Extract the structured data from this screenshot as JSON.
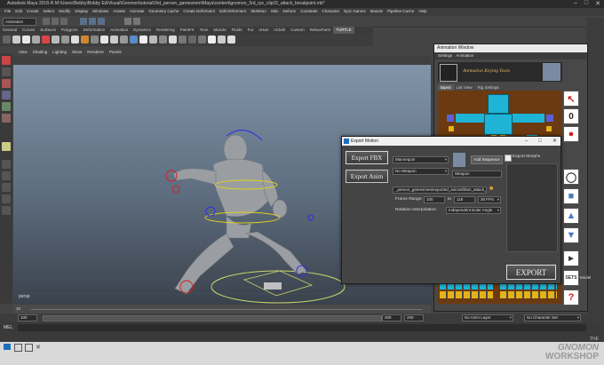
{
  "app": {
    "title": "Autodesk Maya 2018.4\\ M:\\Users\\Bobby\\Bobby Ed\\Visual\\Gnomon\\tutorial\\3rd_person_gamesmen\\Maya\\content\\gnomon_3rd_rpc_clip15_attack_breakpoint.mb*"
  },
  "menus": [
    "File",
    "Edit",
    "Create",
    "Select",
    "Modify",
    "Display",
    "Windows",
    "Assets",
    "Animate",
    "Geometry Cache",
    "Create Deformers",
    "Edit Deformers",
    "Skeleton",
    "Skin",
    "Deform",
    "Constrain",
    "Character",
    "Epic Games",
    "Muscle",
    "Pipeline Cache",
    "Help"
  ],
  "workspace_label": "Animation",
  "shelf_tabs": [
    "General",
    "Curves",
    "Surfaces",
    "Polygons",
    "Deformation",
    "Animation",
    "Dynamics",
    "Rendering",
    "PaintFX",
    "Toon",
    "Muscle",
    "Fluids",
    "Fur",
    "nHair",
    "nCloth",
    "Custom",
    "RebusFarm",
    "TURTLE"
  ],
  "shelf_active": "TURTLE",
  "view_menu": [
    "View",
    "Shading",
    "Lighting",
    "Show",
    "Renderer",
    "Panels"
  ],
  "timeline": {
    "start_frame": "10",
    "current_frame": "100",
    "range": [
      "100",
      "100",
      "200",
      "200"
    ],
    "anim_layer": "No Anim Layer",
    "character_set": "No Character Set"
  },
  "cmd_label": "MEL",
  "anim_window": {
    "title": "Animation Window",
    "menu": [
      "Settings",
      "Animation"
    ],
    "banner_text": "Animation Keying Tools",
    "tabs": [
      "Biped",
      "List View",
      "Rig Settings"
    ],
    "active_tab": "Biped",
    "zero_label": "0",
    "export_label": "EXPORT",
    "model_label": "Model",
    "sets_label": "SETS"
  },
  "export_dialog": {
    "title": "Export Motion",
    "export_fbx": "Export FBX",
    "export_anim": "Export Anim",
    "rig_select": "Mannequin",
    "weapon_select": "No Weapon",
    "weapon_field": "Weapon",
    "add_sequence": "Add Sequence",
    "export_morphs": "Export Morphs",
    "path": "_person_gamesmen/exported_anims/bfam_attack_ind.fbx",
    "frame_range_label": "Frame Range:",
    "frame_start": "100",
    "frame_to": "to",
    "frame_end": "118",
    "fps": "30 FPS",
    "rotation_label": "Rotation Interpolation:",
    "rotation_value": "Independent Euler Angle",
    "export_button": "EXPORT"
  },
  "watermark": {
    "line1": "THE",
    "line2": "GNOMON",
    "line3": "WORKSHOP"
  },
  "colors": {
    "accent_cyan": "#1fb4d6",
    "accent_yellow": "#e4b21a",
    "rig_brown": "#6b3a10",
    "viewport_top": "#8194a9",
    "selection_red": "#d22020"
  }
}
